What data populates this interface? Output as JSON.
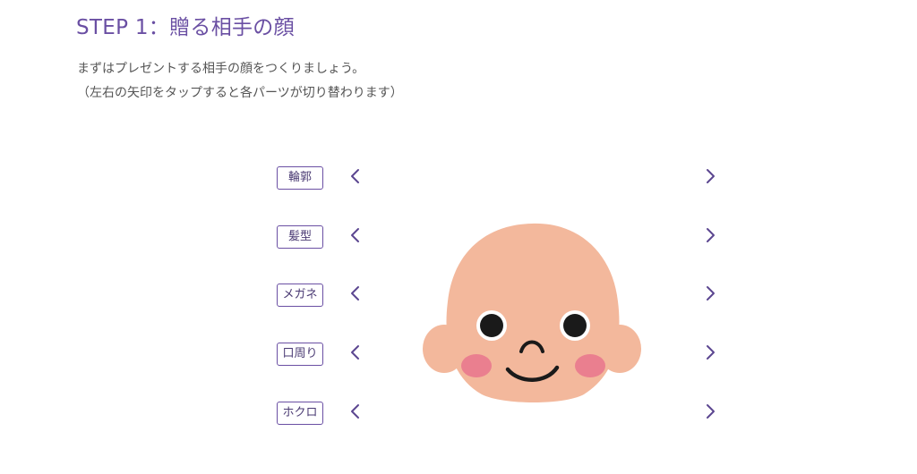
{
  "step": {
    "title": "STEP 1：贈る相手の顔"
  },
  "intro": {
    "line1": "まずはプレゼントする相手の顔をつくりましょう。",
    "line2": "（左右の矢印をタップすると各パーツが切り替わります）"
  },
  "parts": [
    {
      "label": "輪郭"
    },
    {
      "label": "髪型"
    },
    {
      "label": "メガネ"
    },
    {
      "label": "口周り"
    },
    {
      "label": "ホクロ"
    }
  ],
  "icons": {
    "prev": "chevron-left-icon",
    "next": "chevron-right-icon"
  },
  "colors": {
    "accent": "#6a4fa3",
    "skin": "#f3b89c",
    "cheek": "#ea7f8f",
    "text": "#555555"
  }
}
